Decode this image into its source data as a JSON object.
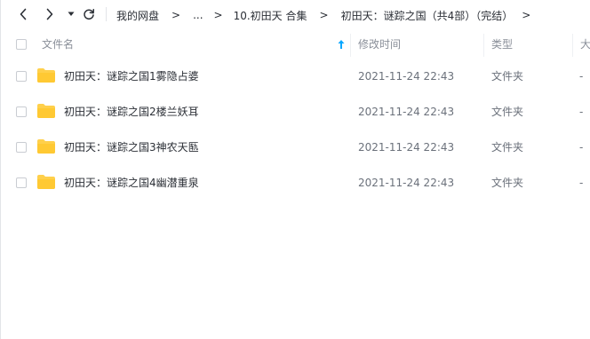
{
  "nav": {
    "back_icon": "chevron-left-icon",
    "forward_icon": "chevron-right-icon",
    "history_icon": "caret-down-icon",
    "refresh_icon": "refresh-icon"
  },
  "breadcrumb": {
    "items": [
      "我的网盘",
      "...",
      "10.初田天 合集",
      "初田天：谜踪之国（共4部）（完结）"
    ],
    "separator": ">"
  },
  "table": {
    "columns": {
      "name": "文件名",
      "modified": "修改时间",
      "type": "类型",
      "size": "大"
    },
    "sort_icon": "arrow-up-icon",
    "accent_color": "#06a7ff",
    "folder_color": "#ffd04b",
    "rows": [
      {
        "name": "初田天：谜踪之国1雾隐占婆",
        "modified": "2021-11-24 22:43",
        "type": "文件夹",
        "size": "-"
      },
      {
        "name": "初田天：谜踪之国2楼兰妖耳",
        "modified": "2021-11-24 22:43",
        "type": "文件夹",
        "size": "-"
      },
      {
        "name": "初田天：谜踪之国3神农天匦",
        "modified": "2021-11-24 22:43",
        "type": "文件夹",
        "size": "-"
      },
      {
        "name": "初田天：谜踪之国4幽潜重泉",
        "modified": "2021-11-24 22:43",
        "type": "文件夹",
        "size": "-"
      }
    ]
  }
}
